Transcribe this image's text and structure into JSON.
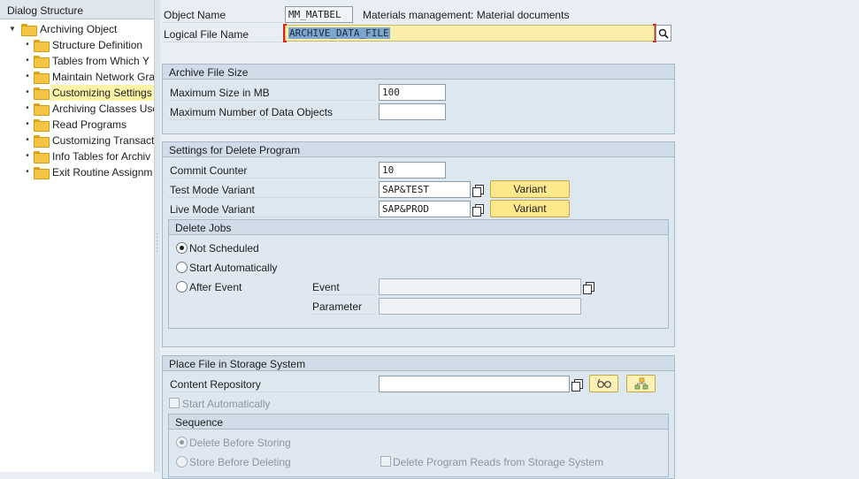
{
  "left": {
    "title": "Dialog Structure",
    "root": "Archiving Object",
    "items": [
      "Structure Definition",
      "Tables from Which Y",
      "Maintain Network Gra",
      "Customizing Settings",
      "Archiving Classes Use",
      "Read Programs",
      "Customizing Transact",
      "Info Tables for Archiv",
      "Exit Routine Assignm"
    ],
    "selected_index": 3
  },
  "header": {
    "object_name_label": "Object Name",
    "object_name_value": "MM_MATBEL",
    "object_description": "Materials management: Material documents",
    "logical_file_label": "Logical File Name",
    "logical_file_value": "ARCHIVE_DATA_FILE"
  },
  "archive_size": {
    "title": "Archive File Size",
    "max_size_label": "Maximum Size in MB",
    "max_size_value": "100",
    "max_objects_label": "Maximum Number of Data Objects",
    "max_objects_value": ""
  },
  "delete_program": {
    "title": "Settings for Delete Program",
    "commit_label": "Commit Counter",
    "commit_value": "10",
    "test_label": "Test Mode Variant",
    "test_value": "SAP&TEST",
    "live_label": "Live Mode Variant",
    "live_value": "SAP&PROD",
    "variant_button": "Variant",
    "jobs": {
      "title": "Delete Jobs",
      "not_scheduled": "Not Scheduled",
      "start_auto": "Start Automatically",
      "after_event": "After Event",
      "event_label": "Event",
      "event_value": "",
      "parameter_label": "Parameter",
      "parameter_value": "",
      "selected": "Not Scheduled"
    }
  },
  "storage": {
    "title": "Place File in Storage System",
    "repo_label": "Content Repository",
    "repo_value": "",
    "start_auto_label": "Start Automatically",
    "sequence": {
      "title": "Sequence",
      "delete_before": "Delete Before Storing",
      "store_before": "Store Before Deleting",
      "delete_reads": "Delete Program Reads from Storage System",
      "selected": "Delete Before Storing"
    }
  },
  "icons": {
    "search": "search-icon",
    "copy": "copy-icon",
    "glasses": "display-icon",
    "hierarchy": "hierarchy-icon",
    "folder": "folder-icon"
  },
  "colors": {
    "selected_tree": "#fdf4a8",
    "input_highlight": "#fbeeaa",
    "button_yellow": "#fde98c",
    "required_marker": "#dd2222"
  }
}
